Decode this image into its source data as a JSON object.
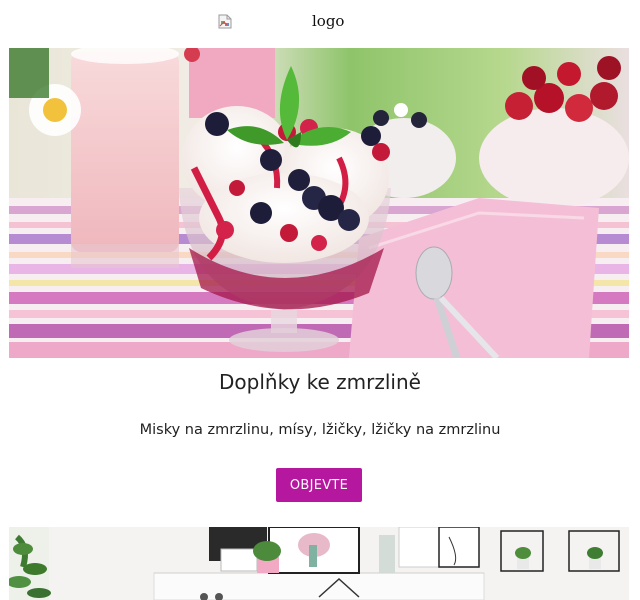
{
  "header": {
    "logo_alt": "logo",
    "logo_icon": "broken-image-icon"
  },
  "hero": {
    "image_subject": "ice-cream-sundae-with-berries"
  },
  "content": {
    "title": "Doplňky ke zmrzlině",
    "subtitle": "Misky na zmrzlinu, mísy, lžičky, lžičky na zmrzlinu",
    "cta_label": "OBJEVTE"
  },
  "second_banner": {
    "image_subject": "interior-shelves-with-plants"
  },
  "colors": {
    "accent": "#b5179e",
    "text": "#222222",
    "background": "#ffffff"
  }
}
